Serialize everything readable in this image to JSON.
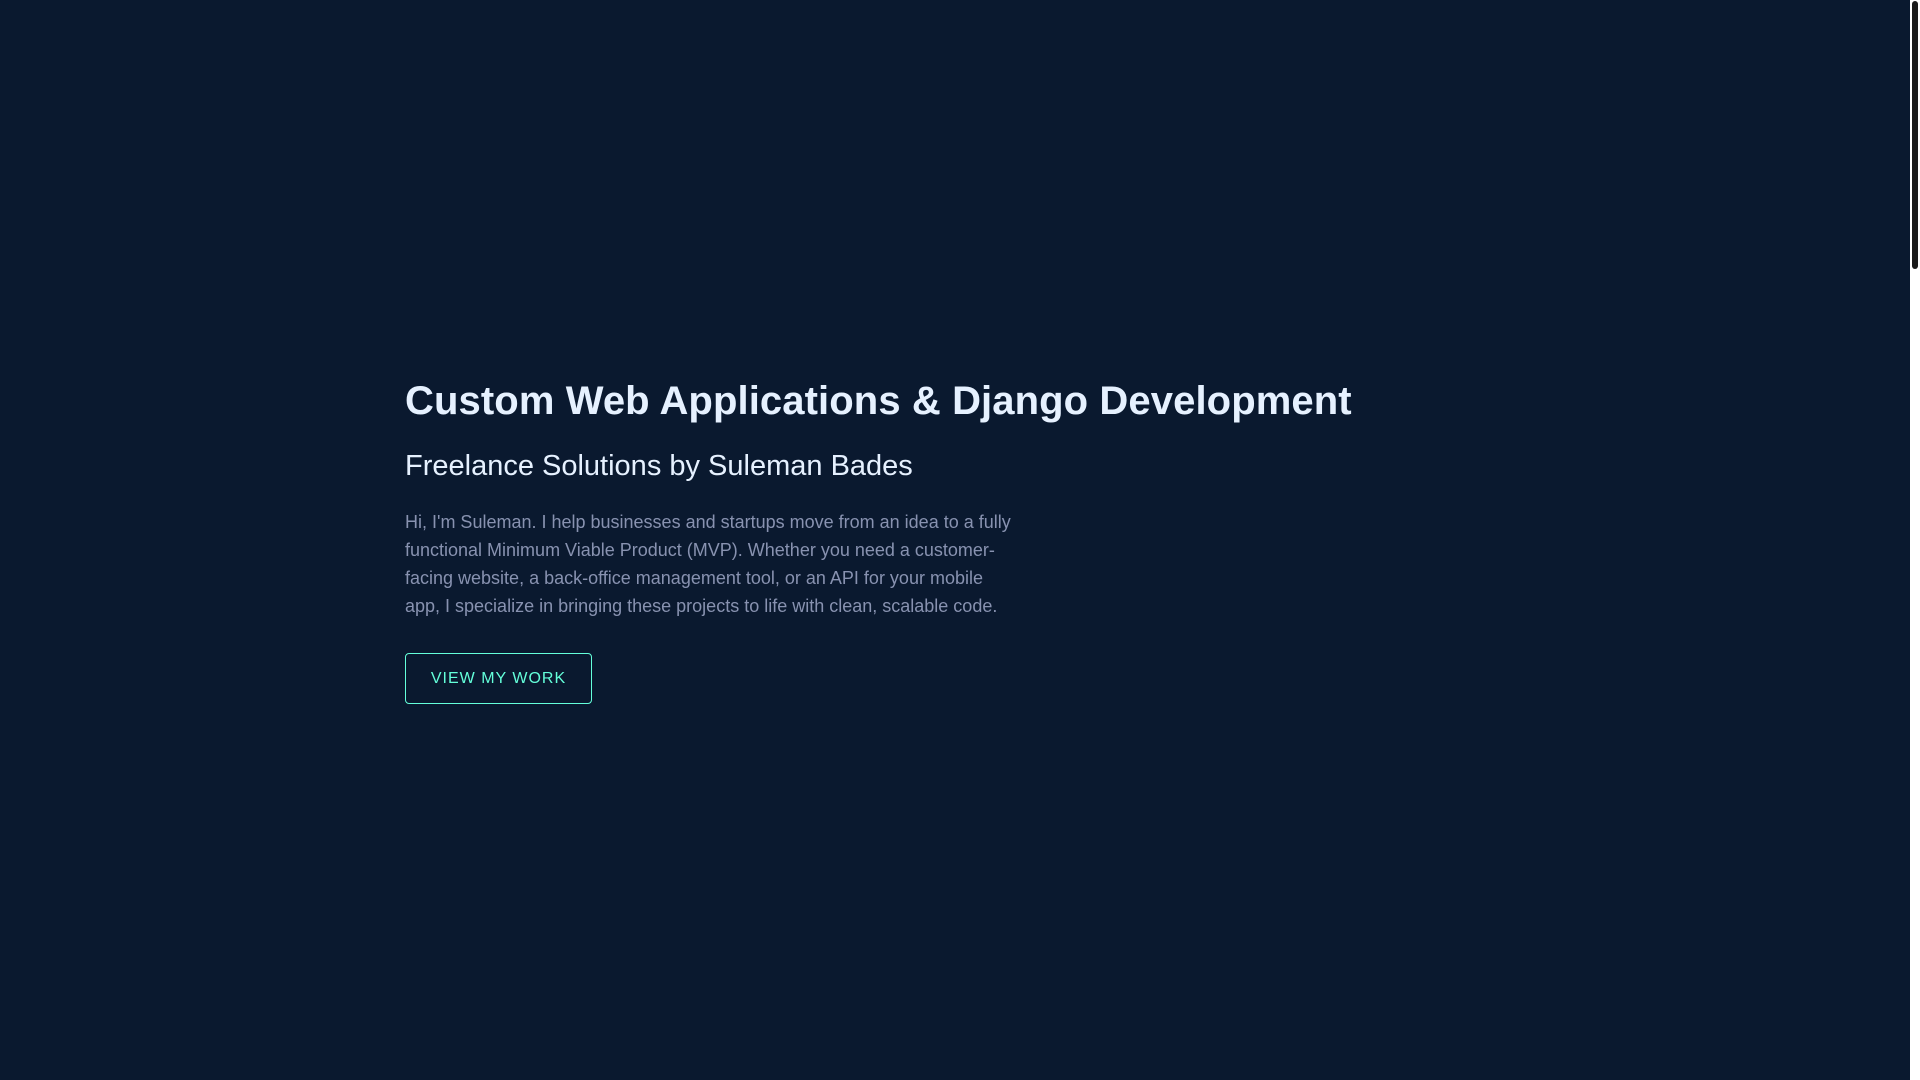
{
  "hero": {
    "title": "Custom Web Applications & Django Development",
    "subtitle": "Freelance Solutions by Suleman Bades",
    "description": "Hi, I'm Suleman. I help businesses and startups move from an idea to a fully functional Minimum Viable Product (MVP). Whether you need a customer-facing website, a back-office management tool, or an API for your mobile app, I specialize in bringing these projects to life with clean, scalable code.",
    "cta_label": "VIEW MY WORK"
  },
  "colors": {
    "background": "#0a192f",
    "heading": "#e6f1ff",
    "body_text": "#8892b0",
    "accent": "#64ffda"
  }
}
